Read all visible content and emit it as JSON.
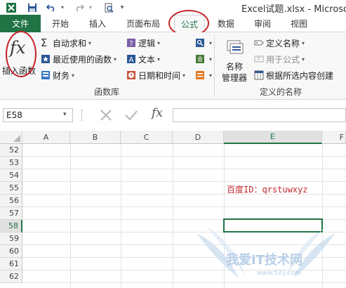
{
  "window": {
    "title": "Excel试题.xlsx - Microso"
  },
  "tabs": {
    "file": "文件",
    "items": [
      "开始",
      "插入",
      "页面布局",
      "公式",
      "数据",
      "审阅",
      "视图"
    ],
    "active": "公式"
  },
  "ribbon": {
    "insert_function": "插入函数",
    "function_library": {
      "autosum": "自动求和",
      "recently_used": "最近使用的函数",
      "financial": "财务",
      "logical": "逻辑",
      "text": "文本",
      "date_time": "日期和时间",
      "group_label": "函数库"
    },
    "defined_names": {
      "name_manager_line1": "名称",
      "name_manager_line2": "管理器",
      "define_name": "定义名称",
      "use_in_formula": "用于公式",
      "create_from_selection": "根据所选内容创建",
      "group_label": "定义的名称"
    }
  },
  "formula_bar": {
    "name_box": "E58",
    "fx_label": "fx",
    "formula": ""
  },
  "sheet": {
    "columns": [
      "A",
      "B",
      "C",
      "D",
      "E",
      "F"
    ],
    "rows": [
      "52",
      "53",
      "54",
      "55",
      "56",
      "57",
      "58",
      "59",
      "60",
      "61",
      "62"
    ],
    "selected_cell": "E58",
    "cell_e55": "百度ID：qrstuwxyz"
  },
  "watermark": {
    "text": "我爱IT技术网",
    "url": "www.52ij.com"
  },
  "colors": {
    "accent": "#217346",
    "annotation_ring": "#c8242a",
    "cell_text_red": "#c0282d"
  }
}
